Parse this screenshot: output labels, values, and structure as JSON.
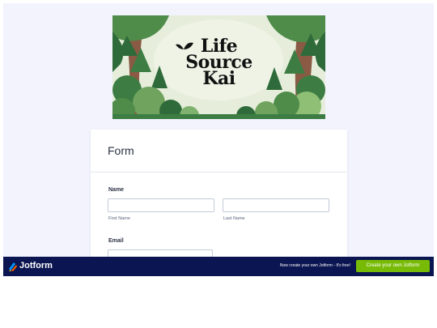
{
  "banner": {
    "logo_lines": [
      "Life",
      "Source",
      "Kai"
    ],
    "colors": {
      "sky": "#dfe9d2",
      "tree_dark": "#2f6b3a",
      "tree_mid": "#4f8c4a",
      "tree_light": "#7fb26e",
      "trunk": "#8a5a44"
    }
  },
  "form": {
    "title": "Form",
    "name_label": "Name",
    "first_name_sublabel": "First Name",
    "last_name_sublabel": "Last Name",
    "email_label": "Email"
  },
  "footer": {
    "brand": "Jotform",
    "promo_text": "Now create your own Jotform - It's free!",
    "cta_label": "Create your own Jotform",
    "colors": {
      "background": "#0a1551",
      "cta": "#78bb07"
    }
  }
}
